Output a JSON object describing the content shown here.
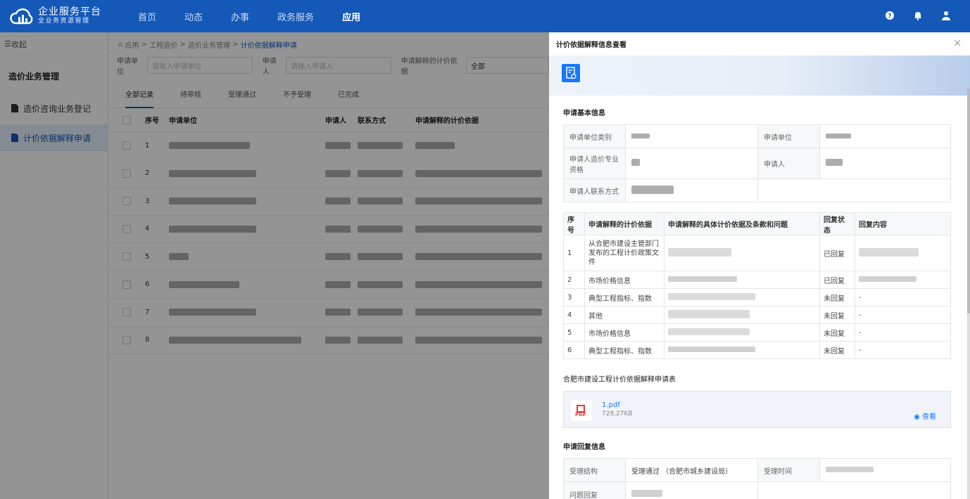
{
  "app": {
    "name": "企业服务平台",
    "subname": "全业务资源管理"
  },
  "nav": [
    "首页",
    "动态",
    "办事",
    "政务服务",
    "应用"
  ],
  "nav_active": "应用",
  "sidebar": {
    "collapse": "收起",
    "title": "造价业务管理",
    "items": [
      "造价咨询业务登记",
      "计价依据解释申请"
    ]
  },
  "breadcrumb": {
    "parts": [
      "应用",
      "工程造价",
      "造价业务管理"
    ],
    "current": "计价依据解释申请"
  },
  "filters": {
    "unit_label": "申请单位",
    "unit_placeholder": "请输入申请单位",
    "applicant_label": "申请人",
    "applicant_placeholder": "请输入申请人",
    "basis_label": "申请解释的计价依据",
    "basis_value": "全部"
  },
  "tabs": [
    "全部记录",
    "待审核",
    "受理通过",
    "不予受理",
    "已完成"
  ],
  "table": {
    "headers": [
      "序号",
      "申请单位",
      "申请人",
      "联系方式",
      "申请解释的计价依据"
    ],
    "rows": [
      "1",
      "2",
      "3",
      "4",
      "5",
      "6",
      "7",
      "8"
    ]
  },
  "drawer": {
    "title": "计价依据解释信息查看",
    "basic_section": "申请基本信息",
    "info_labels": {
      "unit_type": "申请单位类别",
      "unit": "申请单位",
      "qualification": "申请人造价专业资格",
      "applicant": "申请人",
      "contact": "申请人联系方式"
    },
    "reply_headers": [
      "序号",
      "申请解释的计价依据",
      "申请解释的具体计价依据及条款和问题",
      "回复状态",
      "回复内容"
    ],
    "replies": [
      {
        "no": "1",
        "basis": "从合肥市建设主管部门发布的工程计价政策文件",
        "status": "已回复",
        "content": ""
      },
      {
        "no": "2",
        "basis": "市场价格信息",
        "status": "已回复",
        "content": ""
      },
      {
        "no": "3",
        "basis": "典型工程指标、指数",
        "status": "未回复",
        "content": "-"
      },
      {
        "no": "4",
        "basis": "其他",
        "status": "未回复",
        "content": "-"
      },
      {
        "no": "5",
        "basis": "市场价格信息",
        "status": "未回复",
        "content": "-"
      },
      {
        "no": "6",
        "basis": "典型工程指标、指数",
        "status": "未回复",
        "content": "-"
      }
    ],
    "file_section": "合肥市建设工程计价依据解释申请表",
    "file": {
      "name": "1.pdf",
      "size": "728.27KB",
      "view": "查看",
      "icon_text": "PDF"
    },
    "reply_section": "申请回复信息",
    "reply_labels": {
      "structure": "受理结构",
      "time": "受理时间",
      "answer": "问题回复"
    },
    "reply_structure_value": "受理通过 （合肥市城乡建设局）"
  }
}
